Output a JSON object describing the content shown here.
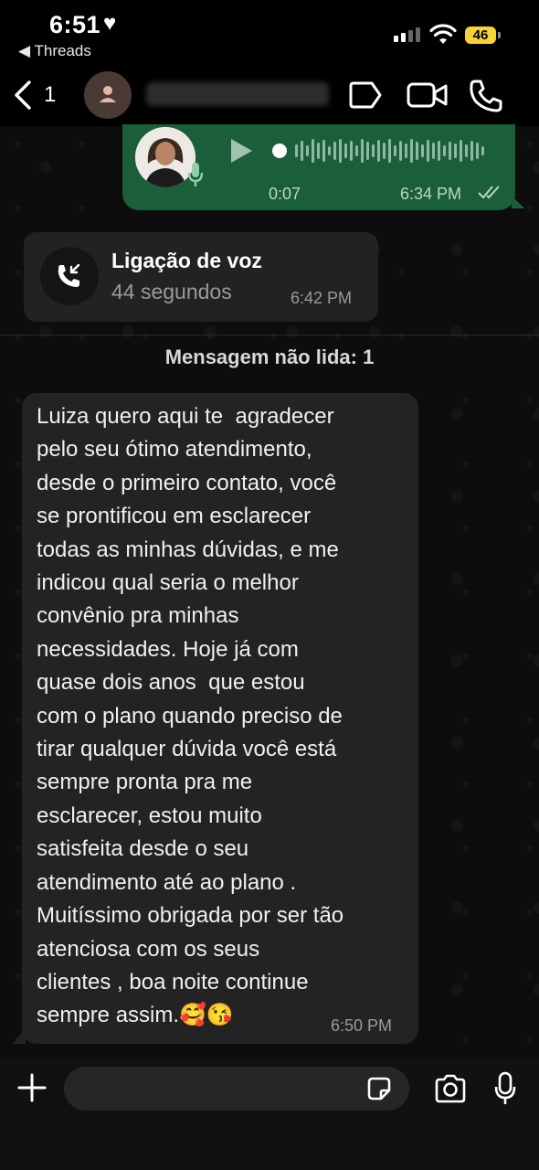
{
  "status_bar": {
    "time": "6:51",
    "heart": "♥",
    "back_app": "◀ Threads",
    "battery": "46"
  },
  "header": {
    "unread_count": "1",
    "contact_name": ""
  },
  "messages": {
    "voice": {
      "duration": "0:07",
      "time": "6:34 PM"
    },
    "call": {
      "title": "Ligação de voz",
      "subtitle": "44 segundos",
      "time": "6:42 PM"
    },
    "unread_divider": "Mensagem não lida: 1",
    "text": {
      "body": "Luiza quero aqui te  agradecer\npelo seu ótimo atendimento,\ndesde o primeiro contato, você\nse prontificou em esclarecer\ntodas as minhas dúvidas, e me\nindicou qual seria o melhor\nconvênio pra minhas\nnecessidades. Hoje já com\nquase dois anos  que estou\ncom o plano quando preciso de\ntirar qualquer dúvida você está\nsempre pronta pra me\nesclarecer, estou muito\nsatisfeita desde o seu\natendimento até ao plano .\nMuitíssimo obrigada por ser tão\natenciosa com os seus\nclientes , boa noite continue\nsempre assim.🥰😘",
      "time": "6:50 PM"
    }
  },
  "input": {
    "placeholder": ""
  },
  "icons": {
    "back": "chevron-left-icon",
    "avatar": "person-icon",
    "label": "label-icon",
    "video": "video-camera-icon",
    "phone": "phone-icon",
    "play": "play-icon",
    "mic_badge": "mic-icon",
    "read_ticks": "double-check-icon",
    "call": "incoming-call-icon",
    "plus": "plus-icon",
    "sticker": "sticker-icon",
    "camera": "camera-icon",
    "mic": "mic-icon"
  },
  "colors": {
    "outgoing_bubble": "#1a5f39",
    "incoming_bubble": "#232323",
    "battery": "#f6d33b"
  }
}
